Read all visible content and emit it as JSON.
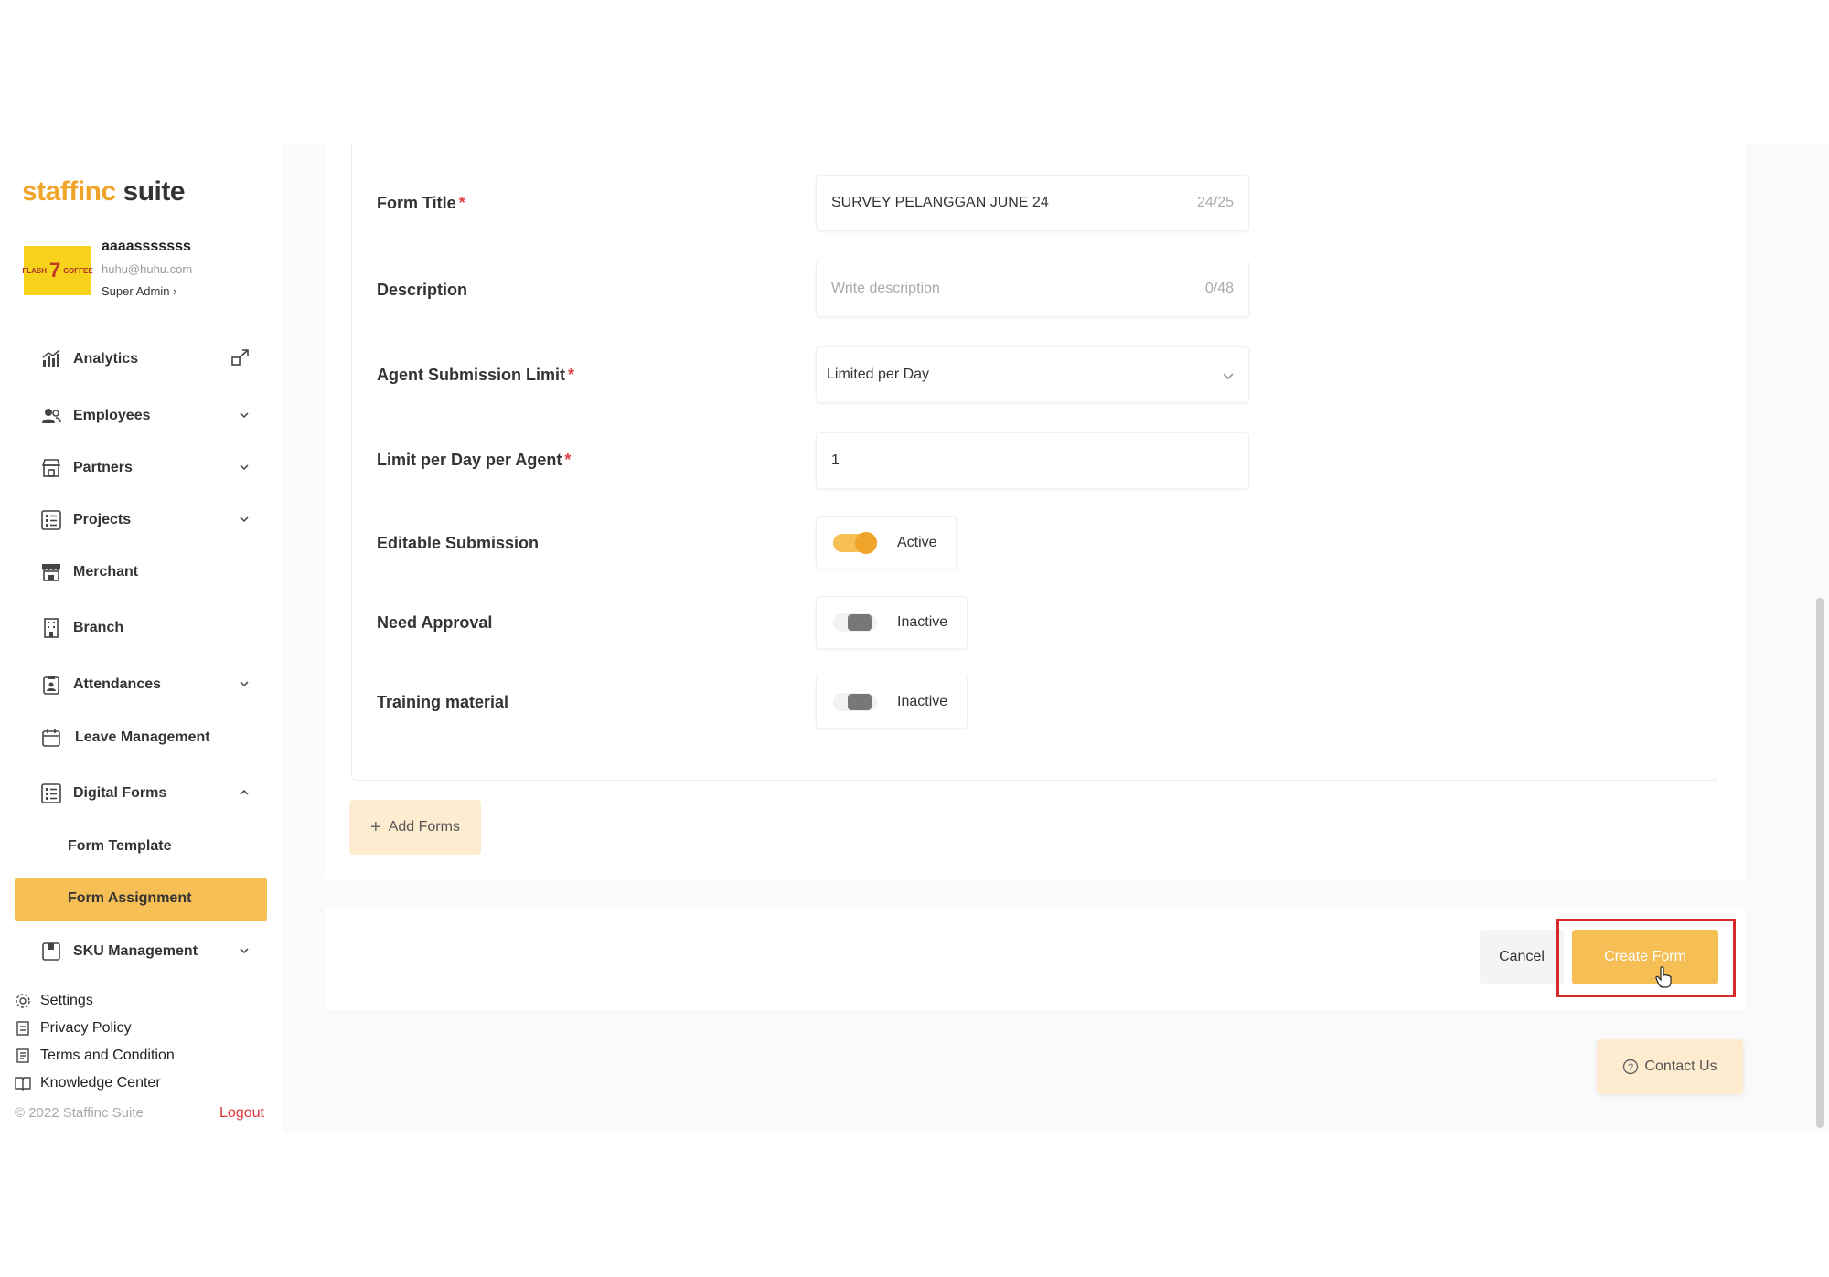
{
  "brand": {
    "name_part1": "staff",
    "name_part2": "inc",
    "name_part3": " suite"
  },
  "profile": {
    "name": "aaaasssssss",
    "email": "huhu@huhu.com",
    "role": "Super Admin"
  },
  "nav": [
    {
      "label": "Analytics",
      "icon": "analytics-icon"
    },
    {
      "label": "Employees",
      "icon": "users-icon"
    },
    {
      "label": "Partners",
      "icon": "store-icon"
    },
    {
      "label": "Projects",
      "icon": "list-icon"
    },
    {
      "label": "Merchant",
      "icon": "merchant-icon"
    },
    {
      "label": "Branch",
      "icon": "building-icon"
    },
    {
      "label": "Attendances",
      "icon": "clipboard-icon"
    },
    {
      "label": "Leave Management",
      "icon": "calendar-icon"
    },
    {
      "label": "Digital Forms",
      "icon": "forms-icon"
    },
    {
      "label": "SKU Management",
      "icon": "box-icon"
    }
  ],
  "sub_nav": {
    "form_template": "Form Template",
    "form_assignment": "Form Assignment"
  },
  "footer": {
    "settings": "Settings",
    "privacy": "Privacy Policy",
    "terms": "Terms and Condition",
    "knowledge": "Knowledge Center",
    "copyright": "© 2022 Staffinc Suite",
    "logout": "Logout"
  },
  "form": {
    "title_label": "Form Title",
    "title_value": "SURVEY PELANGGAN JUNE 24",
    "title_count": "24/25",
    "desc_label": "Description",
    "desc_placeholder": "Write description",
    "desc_count": "0/48",
    "limit_label": "Agent Submission Limit",
    "limit_value": "Limited per Day",
    "per_day_label": "Limit per Day per Agent",
    "per_day_value": "1",
    "editable_label": "Editable Submission",
    "editable_status": "Active",
    "approval_label": "Need Approval",
    "approval_status": "Inactive",
    "training_label": "Training material",
    "training_status": "Inactive",
    "required_mark": "*"
  },
  "actions": {
    "add_forms": "Add Forms",
    "cancel": "Cancel",
    "create": "Create Form",
    "contact": "Contact Us"
  },
  "colors": {
    "accent": "#f5bf55",
    "accent_dark": "#f0a42a",
    "highlight": "#d42a2a"
  }
}
